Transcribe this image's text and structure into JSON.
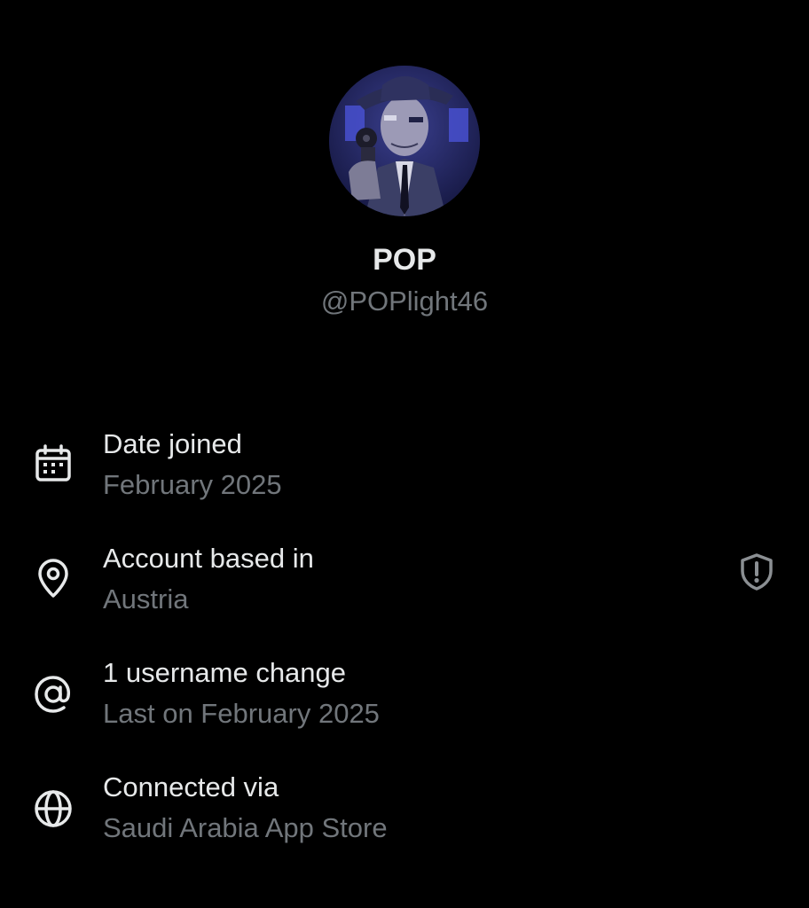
{
  "profile": {
    "display_name": "POP",
    "handle": "@POPlight46",
    "avatar": "avatar-image"
  },
  "info": [
    {
      "icon": "calendar-icon",
      "title": "Date joined",
      "subtitle": "February 2025"
    },
    {
      "icon": "location-pin-icon",
      "title": "Account based in",
      "subtitle": "Austria",
      "trailing_icon": "shield-alert-icon"
    },
    {
      "icon": "at-sign-icon",
      "title": "1 username change",
      "subtitle": "Last on February 2025"
    },
    {
      "icon": "globe-icon",
      "title": "Connected via",
      "subtitle": "Saudi Arabia App Store"
    }
  ],
  "colors": {
    "background": "#000000",
    "primary_text": "#e7e9ea",
    "secondary_text": "#71767b",
    "icon": "#e7e9ea",
    "shield": "#8b8f93"
  }
}
